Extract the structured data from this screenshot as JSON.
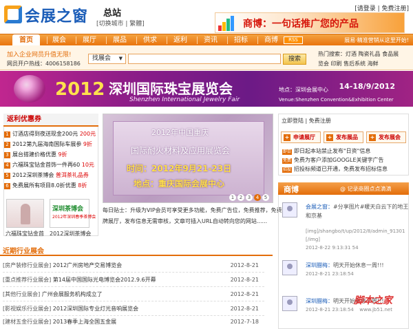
{
  "header": {
    "logo_text": "会展之窗",
    "site_title": "总站",
    "site_sub": "[切换城市 | 繁體]",
    "top_links": "[请登录 | 免费注册]",
    "ad_text": "商博：一句话推广您的产品"
  },
  "nav": {
    "items": [
      "首页",
      "展会",
      "展厅",
      "展品",
      "供求",
      "返利",
      "资讯",
      "招标",
      "商博"
    ],
    "rss": "RSS",
    "promo": "展易·精准营销从这里开始!"
  },
  "search": {
    "join": "加入企业网员升值无限!",
    "hotline": "网员开户热线：4006158186",
    "select_value": "找展会",
    "button": "搜索",
    "hot1": "热门搜索：灯酒 陶瓷礼品 食品展",
    "hot2": "览会 印刷 售后系统 海鲜"
  },
  "banner": {
    "year": "2012",
    "title": "深圳国际珠宝展览会",
    "en": "Shenzhen International Jewelry Fair",
    "date": "14-18/9/2012",
    "place": "地点：深圳会展中心",
    "venue": "Venue:Shenzhen Convention&Exhibition Center"
  },
  "recommend": {
    "title": "返利优惠券",
    "items": [
      {
        "n": "1",
        "text": "订酒店得到夜送现金200元",
        "hl": "200元"
      },
      {
        "n": "2",
        "text": "2012第九届海南国际车展参",
        "hl": "9折"
      },
      {
        "n": "3",
        "text": "展台搭建价格优惠",
        "hl": "9折"
      },
      {
        "n": "4",
        "text": "六福珠宝钻金首饰一件再60",
        "hl": "10元"
      },
      {
        "n": "5",
        "text": "2012深圳茶博会",
        "hl": "普洱茶礼品券"
      },
      {
        "n": "6",
        "text": "免费展所有项目8.0折优惠",
        "hl": "8折"
      }
    ],
    "thumb2_title": "深圳茶博会",
    "thumb2_sub": "2012年深圳春季茶博会",
    "cap1": "六福珠宝钻金首",
    "cap2": "2012深圳茶博会"
  },
  "slide": {
    "l1": "2012年中国重庆",
    "l2": "国际耐火材料及应用展览会",
    "l3": "时间：2012年9月21-23日",
    "l4": "地点：重庆国际会展中心",
    "dots": [
      "1",
      "2",
      "3",
      "4",
      "5"
    ],
    "news1": "每日贴士：升级为VIP会员可享受更多功能，免费广告位，免费推荐，免费晶",
    "news2": "牌展厅，发布信息无需审核，文章可插入URL自动转向您的网站......"
  },
  "right": {
    "top": "立即登陆 | 免费注册",
    "btn1": "申请展厅",
    "btn2": "发布展品",
    "btn3": "发布展会",
    "info": [
      {
        "tag": "即日",
        "text": "即日起本站禁止发布\"日资\"信息"
      },
      {
        "tag": "免费",
        "text": "免费为客户添加GOOGLE关键字广告"
      },
      {
        "tag": "招投",
        "text": "招投标频道已开通，免费发布招标信息"
      }
    ],
    "shangbo_title": "商博",
    "shangbo_link": "@ 记录商圈点点滴滴"
  },
  "posts": [
    {
      "name": "会展之窗：",
      "txt": "#分享图片#暖天白云下的地王",
      "txt2": "和京基",
      "meta": "[img]/shangbo/t/up/2012/8/admin_91301",
      "meta2": "[/img]",
      "meta3": "2012-8-22 9:13:31 54"
    },
    {
      "name": "深圳腊梅：",
      "txt": "明天开始休息一周!!!",
      "meta": "2012-8-21 23:18:54"
    },
    {
      "name": "深圳腊梅：",
      "txt": "明天开始休息一周!!!",
      "meta": "2012-8-21 23:18:54"
    }
  ],
  "recent": {
    "title": "近期行业展会",
    "rows": [
      {
        "cat": "[房产装修行业展会]",
        "text": "2012广州房地产交易博览会",
        "date": "2012-8-21"
      },
      {
        "cat": "[重点推荐行业展会]",
        "text": "第14届中国国际光电博览会2012.9.6开幕",
        "date": "2012-8-21"
      },
      {
        "cat": "[其他行业展会]",
        "text": "广州会展服务机构成立了",
        "date": "2012-8-21"
      },
      {
        "cat": "[影视娱乐行业展会]",
        "text": "2012深圳国际专业灯光音响展览会",
        "date": "2012-8-21"
      },
      {
        "cat": "[建材五金行业展会]",
        "text": "2013春季上海全国五金展",
        "date": "2012-7-18"
      }
    ]
  },
  "watermark": {
    "text": "脚本之家",
    "sub": "www.jb51.net"
  },
  "colors": {
    "accent": "#e36d0a",
    "brand": "#1b5db8",
    "alert": "#cc0000"
  }
}
